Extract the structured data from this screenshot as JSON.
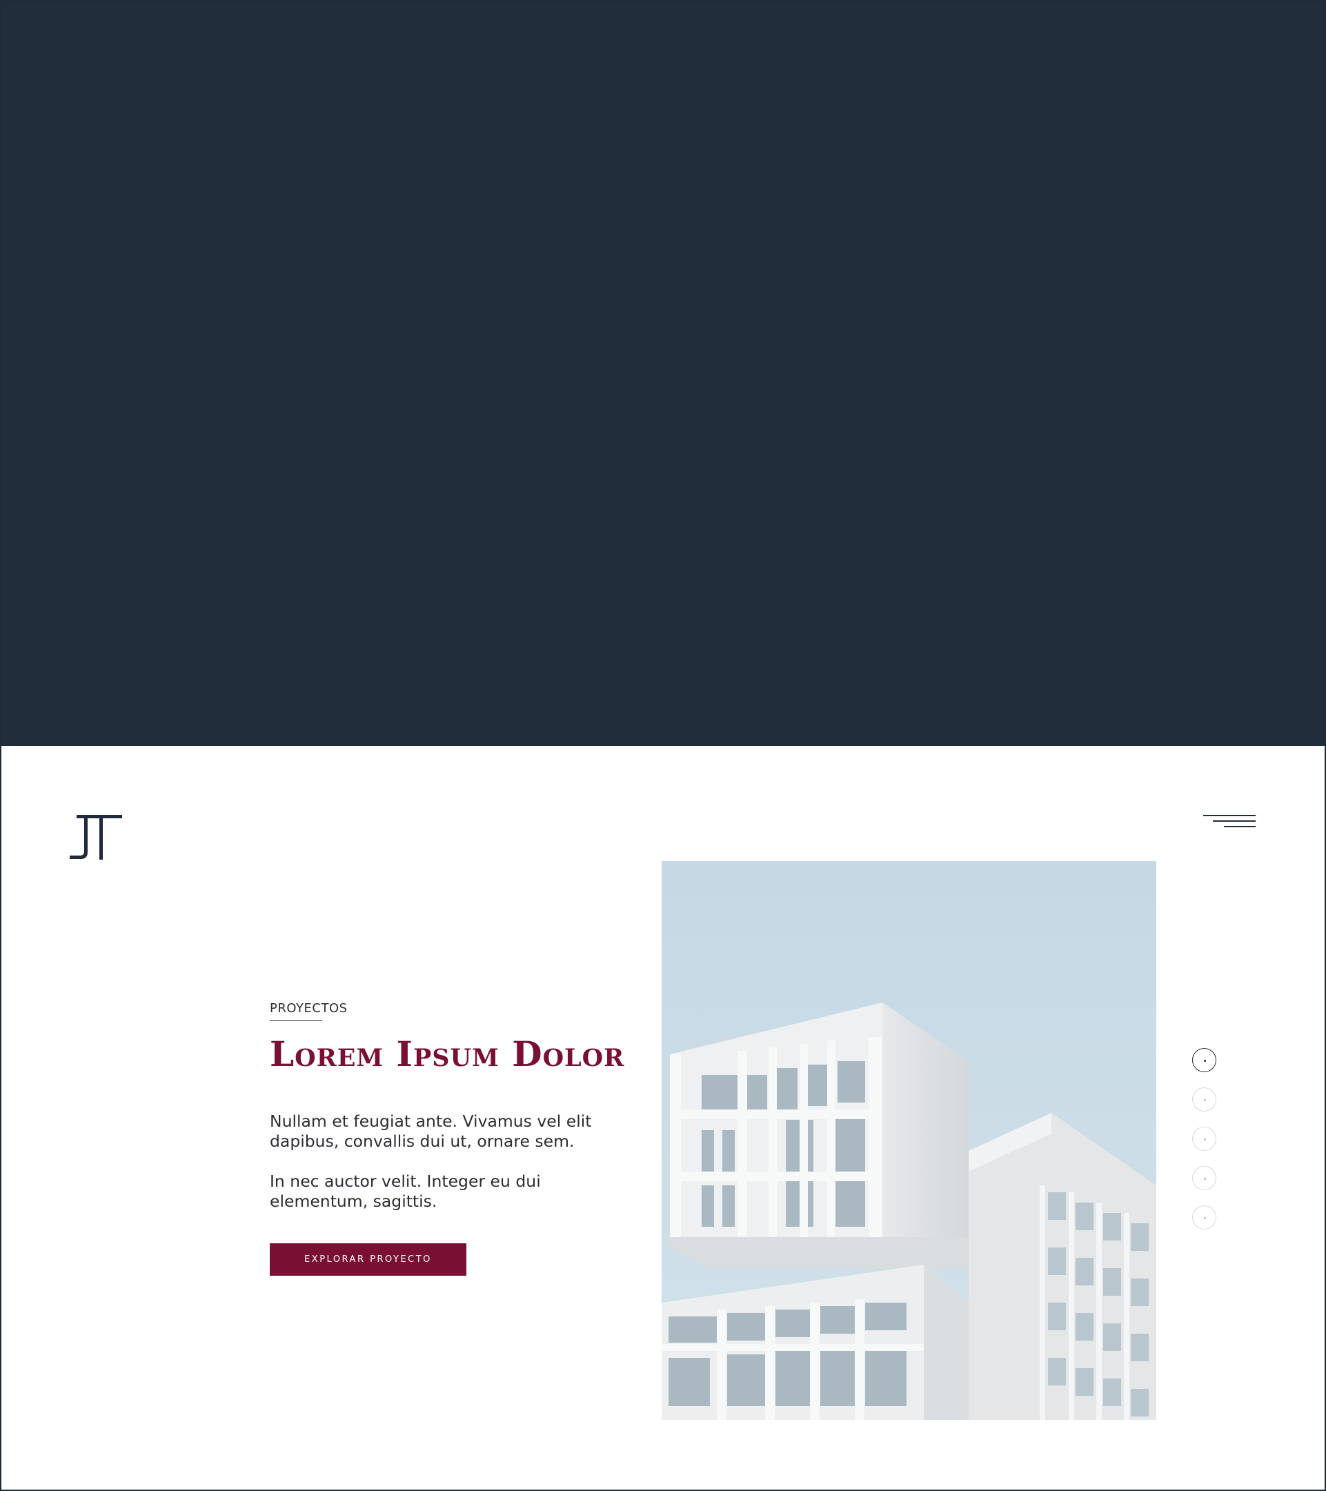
{
  "brand": {
    "logo_text": "JT"
  },
  "menu": {
    "icon": "hamburger-menu-icon"
  },
  "project": {
    "eyebrow": "PROYECTOS",
    "title": "Lorem Ipsum Dolor",
    "paragraph_1": "Nullam et feugiat ante. Vivamus vel elit dapibus, convallis dui ut, ornare sem.",
    "paragraph_2": "In nec auctor velit. Integer eu dui elementum, sagittis.",
    "cta_label": "EXPLORAR PROYECTO"
  },
  "slider": {
    "count": 5,
    "active_index": 0
  },
  "colors": {
    "hero_background": "#212d3b",
    "accent": "#7a0f34",
    "text": "#2a2f36",
    "sky": "#c8dae5"
  }
}
